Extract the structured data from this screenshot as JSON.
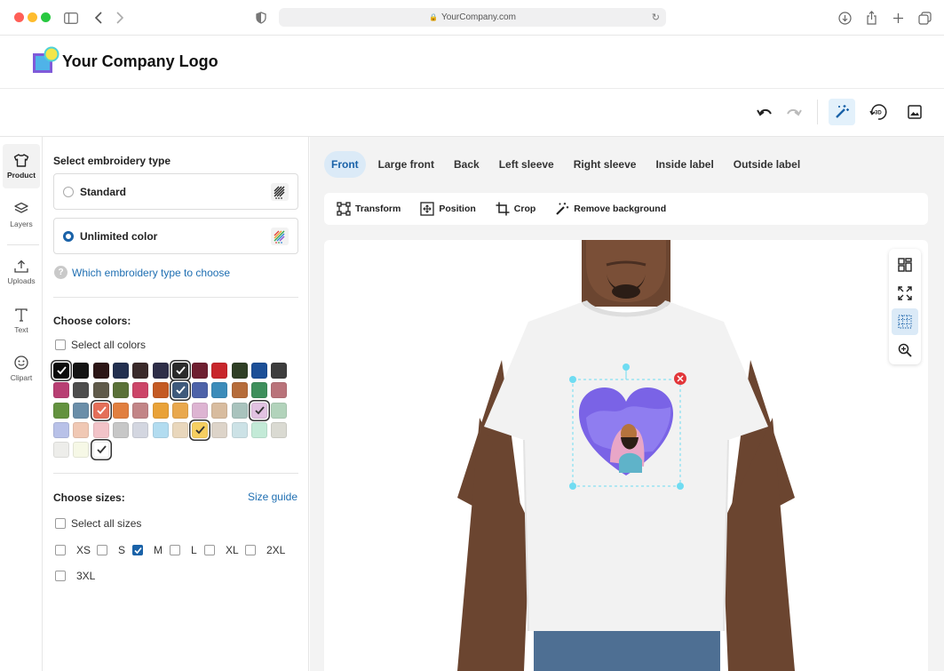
{
  "browser": {
    "url": "YourCompany.com"
  },
  "header": {
    "logo_text": "Your Company Logo"
  },
  "rail": [
    {
      "label": "Product",
      "icon": "tshirt-icon"
    },
    {
      "label": "Layers",
      "icon": "layers-icon"
    },
    {
      "label": "Uploads",
      "icon": "upload-icon"
    },
    {
      "label": "Text",
      "icon": "text-icon"
    },
    {
      "label": "Clipart",
      "icon": "smiley-icon"
    }
  ],
  "embroidery": {
    "title": "Select embroidery type",
    "options": [
      {
        "label": "Standard",
        "selected": false
      },
      {
        "label": "Unlimited color",
        "selected": true
      }
    ],
    "help_text": "Which embroidery type to choose"
  },
  "colors": {
    "title": "Choose colors:",
    "select_all": "Select all colors",
    "swatches": [
      [
        "#0b0b0b",
        "#141414",
        "#2c1616",
        "#233050",
        "#3a2a2a",
        "#2e2e48",
        "#2b2b2b",
        "#6e1f30",
        "#c8262b",
        "#2f3f25",
        "#1c4f97",
        "#3d3d3d"
      ],
      [
        "#b83f73",
        "#4d4d4d",
        "#5f5a4a",
        "#5a7138",
        "#cc4568",
        "#c45a23",
        "#3f5a7c",
        "#4d62a8",
        "#3c8cba",
        "#b66c3a",
        "#3e8f5c",
        "#b9737a"
      ],
      [
        "#63923f",
        "#6a8ea9",
        "#e46f59",
        "#e17f3f",
        "#c28587",
        "#e9a238",
        "#e9a84d",
        "#ddb4d2",
        "#d8bc9f",
        "#a9c3bd",
        "#e1c2e1",
        "#b2d3bb"
      ],
      [
        "#b8c1e8",
        "#f0c8b4",
        "#f2c3c8",
        "#c7c7c7",
        "#d3d6e0",
        "#b2dcf0",
        "#e9d7bc",
        "#f6cf61",
        "#ddd4c9",
        "#cce2e6",
        "#c3ead7",
        "#dadad2"
      ],
      [
        "#ededea",
        "#f6f8e6",
        "#ffffff"
      ]
    ],
    "selected": [
      [
        0,
        0
      ],
      [
        0,
        6
      ],
      [
        1,
        6
      ],
      [
        2,
        2
      ],
      [
        2,
        10
      ],
      [
        3,
        7
      ],
      [
        4,
        2
      ]
    ]
  },
  "sizes": {
    "title": "Choose sizes:",
    "guide": "Size guide",
    "select_all": "Select all sizes",
    "options": [
      {
        "label": "XS",
        "checked": false
      },
      {
        "label": "S",
        "checked": false
      },
      {
        "label": "M",
        "checked": true
      },
      {
        "label": "L",
        "checked": false
      },
      {
        "label": "XL",
        "checked": false
      },
      {
        "label": "2XL",
        "checked": false
      },
      {
        "label": "3XL",
        "checked": false
      }
    ]
  },
  "placement_tabs": [
    {
      "label": "Front",
      "active": true
    },
    {
      "label": "Large front",
      "active": false
    },
    {
      "label": "Back",
      "active": false
    },
    {
      "label": "Left sleeve",
      "active": false
    },
    {
      "label": "Right sleeve",
      "active": false
    },
    {
      "label": "Inside label",
      "active": false
    },
    {
      "label": "Outside label",
      "active": false
    }
  ],
  "image_tools": [
    {
      "label": "Transform",
      "icon": "transform-icon"
    },
    {
      "label": "Position",
      "icon": "position-icon"
    },
    {
      "label": "Crop",
      "icon": "crop-icon"
    },
    {
      "label": "Remove background",
      "icon": "magic-wand-icon"
    }
  ],
  "theme": {
    "accent": "#1a62a8",
    "accent_light": "#dbeaf7",
    "handle": "#6fdcf2",
    "delete": "#e2363a"
  }
}
